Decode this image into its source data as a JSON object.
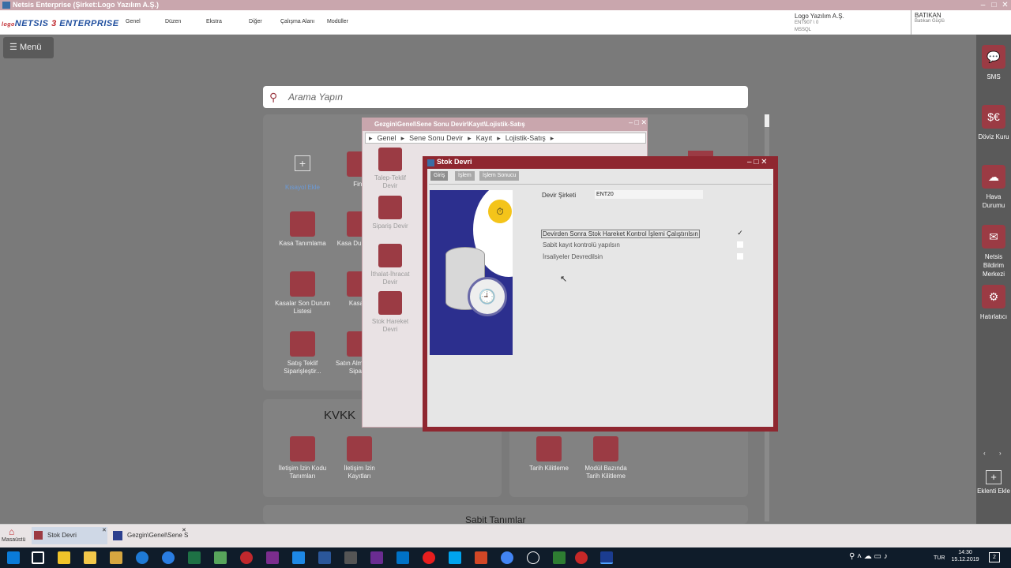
{
  "window": {
    "title": "Netsis Enterprise (Şirket:Logo Yazılım A.Ş.)"
  },
  "brand": {
    "prefix": "logo",
    "name_part1": "NETSIS ",
    "name_num": "3",
    "name_part2": " ENTERPRISE"
  },
  "menu": [
    "Genel",
    "Düzen",
    "Ekstra",
    "Diğer",
    "Çalışma Alanı",
    "Modüller"
  ],
  "company": {
    "name": "Logo Yazılım A.Ş.",
    "line2": "ENT907 \\ 0",
    "line3": "MSSQL"
  },
  "user": {
    "name": "BATIKAN",
    "full": "Batıkan Güçlü"
  },
  "menu_button": "Menü",
  "search": {
    "placeholder": "Arama Yapın"
  },
  "tiles": {
    "add": "Kısayol Ekle",
    "fin": "Fina",
    "kasa_tanimlama": "Kasa Tanımlama",
    "kasa_durum": "Kasa Durum",
    "kasalar_son": "Kasalar Son Durum Listesi",
    "kasa_r": "Kasa R",
    "satis_teklif": "Satış Teklif Siparişleştir...",
    "satin": "Satın Alma Talep Siparişi"
  },
  "kvkk": {
    "title": "KVKK",
    "items": [
      "İletişim İzin Kodu Tanımları",
      "İletişim İzin Kayıtları"
    ]
  },
  "kilit": {
    "items": [
      "Tarih Kilitleme",
      "Modül Bazında Tarih Kilitleme"
    ]
  },
  "sabit": {
    "title": "Sabit Tanımlar"
  },
  "rightbar": [
    "SMS",
    "Döviz Kuru",
    "Hava Durumu",
    "Netsis Bildirim Merkezi",
    "Hatırlatıcı",
    "Eklenti Ekle"
  ],
  "gezgin": {
    "title": "Gezgin\\Genel\\Sene Sonu Devir\\Kayıt\\Lojistik-Satış",
    "breadcrumb": [
      "Genel",
      "Sene Sonu Devir",
      "Kayıt",
      "Lojistik-Satış"
    ],
    "items": [
      "Talep-Teklif Devir",
      "Sipariş Devir",
      "İthalat-İhracat Devir",
      "Stok Hareket Devri"
    ]
  },
  "stok": {
    "title": "Stok Devri",
    "tabs": [
      "Giriş",
      "İşlem",
      "İşlem Sonucu"
    ],
    "devir_label": "Devir Şirketi",
    "devir_value": "ENT20",
    "options": [
      {
        "label": "Devirden Sonra Stok Hareket Kontrol İşlemi Çalıştırılsın",
        "checked": true
      },
      {
        "label": "Sabit kayıt kontrolü yapılsın",
        "checked": false
      },
      {
        "label": "İrsaliyeler Devredilsin",
        "checked": false
      }
    ]
  },
  "taskbar": {
    "desktop": "Masaüstü",
    "tasks": [
      "Stok Devri",
      "Gezgin\\Genel\\Sene So"
    ]
  },
  "tray": {
    "lang": "TUR",
    "time": "14:30",
    "date": "15.12.2019",
    "notif": "2"
  }
}
